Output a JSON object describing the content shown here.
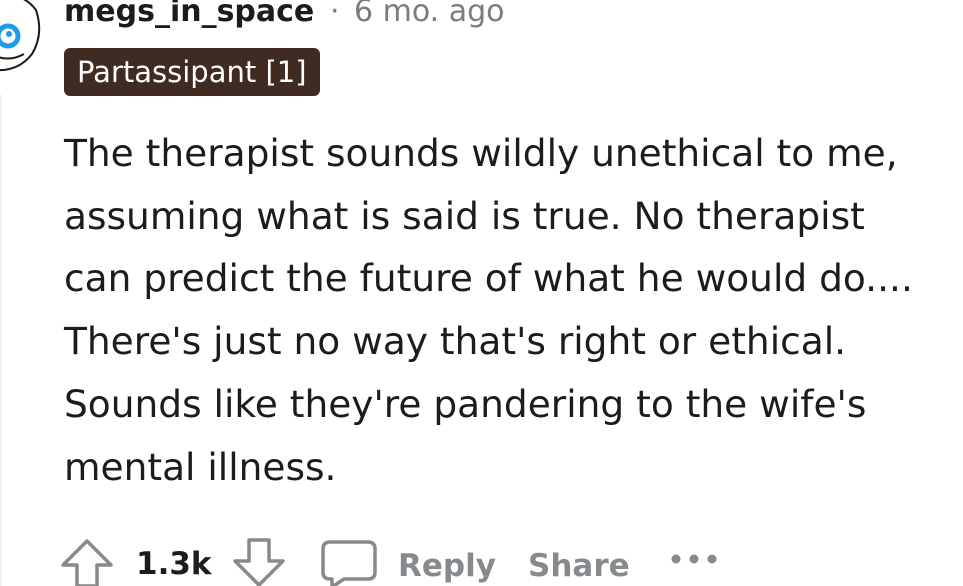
{
  "comment": {
    "username": "megs_in_space",
    "separator": "·",
    "timestamp": "6 mo. ago",
    "flair": "Partassipant [1]",
    "body_lines": [
      "The therapist sounds wildly unethical to me,",
      "assuming what is said is true. No therapist",
      "can predict the future of what he would do....",
      "There's just no way that's right or ethical.",
      "Sounds like they're pandering to the wife's",
      "mental illness."
    ]
  },
  "actions": {
    "score": "1.3k",
    "reply_label": "Reply",
    "share_label": "Share"
  },
  "icons": {
    "avatar": "snoo-avatar-icon",
    "upvote": "upvote-arrow-icon",
    "downvote": "downvote-arrow-icon",
    "reply": "comment-bubble-icon",
    "more": "more-options-icon"
  },
  "colors": {
    "flair_background": "#3f2b22",
    "muted_text": "#7c7c7c",
    "action_text": "#878a8c",
    "avatar_blue": "#1e9ce8"
  }
}
